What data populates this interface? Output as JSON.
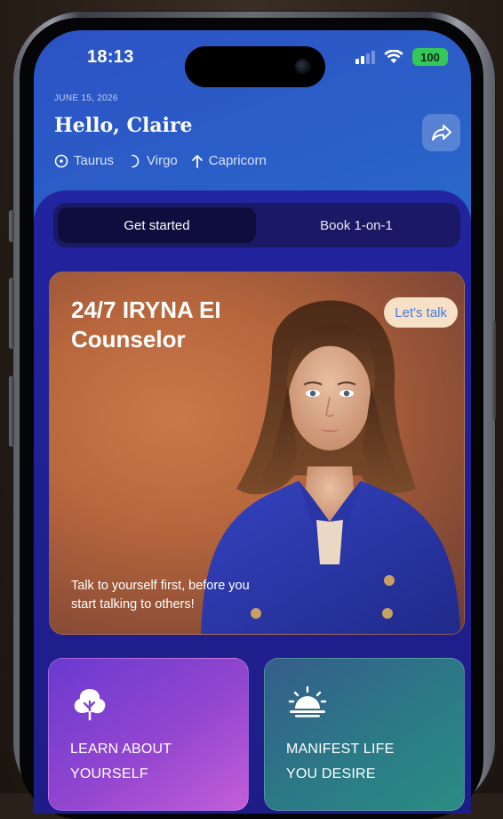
{
  "status_bar": {
    "time": "18:13",
    "battery": "100",
    "icons": [
      "cellular-signal-icon",
      "wifi-icon",
      "battery-icon"
    ]
  },
  "header": {
    "date": "JUNE 15, 2026",
    "greeting": "Hello, Claire",
    "share_icon": "share-arrow-icon",
    "signs": [
      {
        "icon": "sun-sign-icon",
        "label": "Taurus"
      },
      {
        "icon": "moon-sign-icon",
        "label": "Virgo"
      },
      {
        "icon": "rising-sign-icon",
        "label": "Capricorn"
      }
    ]
  },
  "tabs": [
    {
      "label": "Get started",
      "active": true
    },
    {
      "label": "Book 1-on-1",
      "active": false
    }
  ],
  "hero": {
    "title_line1": "24/7 IRYNA EI",
    "title_line2": "Counselor",
    "badge": "Let's talk",
    "caption_line1": "Talk to yourself first, before you",
    "caption_line2": "start talking to others!"
  },
  "cards": [
    {
      "icon": "tree-icon",
      "line1": "LEARN ABOUT",
      "line2": "YOURSELF"
    },
    {
      "icon": "sunrise-icon",
      "line1": "MANIFEST LIFE",
      "line2": "YOU DESIRE"
    }
  ],
  "colors": {
    "screen_top": "#2c52c4",
    "screen_bottom": "#1ba3a6",
    "panel": "#21208c",
    "tab_active": "#0f0d3d",
    "hero_warm": "#c8794a",
    "badge_bg": "#f7e1c6",
    "badge_text": "#4a78e0",
    "battery": "#34c759"
  }
}
